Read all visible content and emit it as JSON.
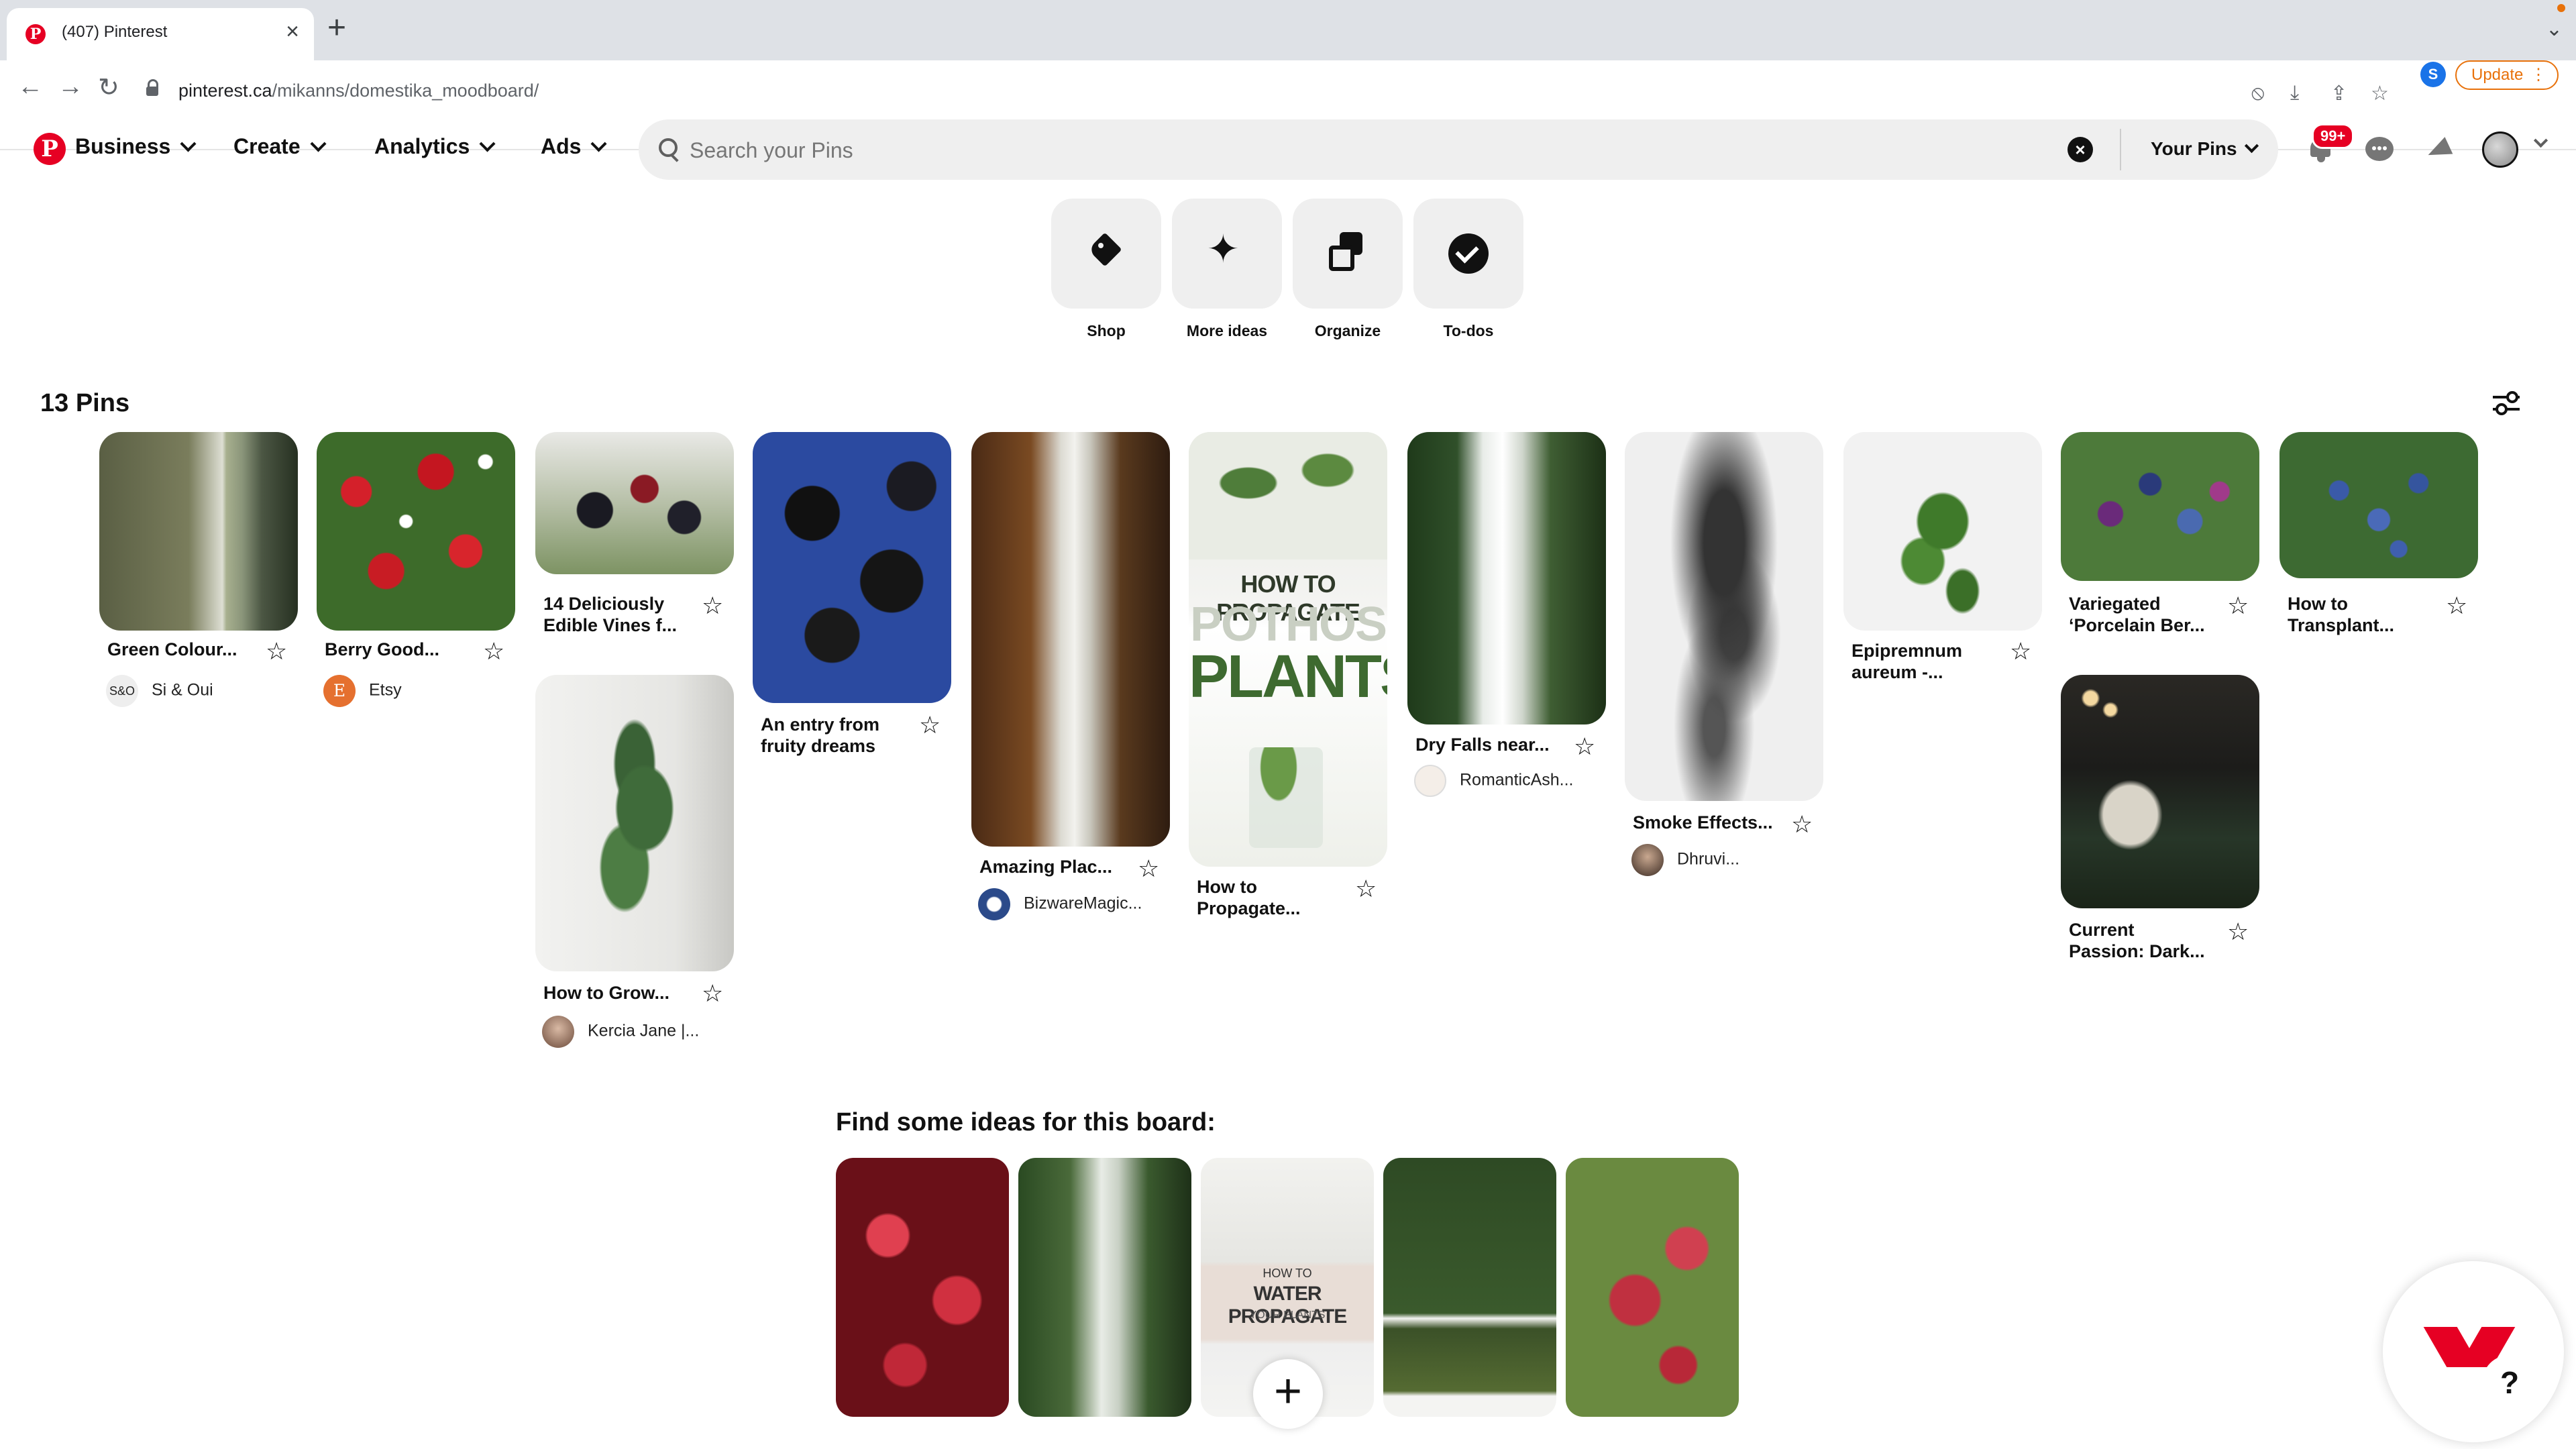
{
  "browser": {
    "tab_title": "(407) Pinterest",
    "url_host": "pinterest.ca",
    "url_path": "/mikanns/domestika_moodboard/",
    "profile_initial": "S",
    "update_label": "Update"
  },
  "header": {
    "nav": [
      "Business",
      "Create",
      "Analytics",
      "Ads"
    ],
    "search_placeholder": "Search your Pins",
    "your_pins_label": "Your Pins",
    "notifications_badge": "99+"
  },
  "tools": [
    {
      "label": "Shop",
      "icon": "tag-icon"
    },
    {
      "label": "More ideas",
      "icon": "sparkle-icon"
    },
    {
      "label": "Organize",
      "icon": "organize-icon"
    },
    {
      "label": "To-dos",
      "icon": "check-circle-icon"
    }
  ],
  "board": {
    "pin_count": "13 Pins"
  },
  "pins": [
    {
      "title1": "Green Colour...",
      "title2": "",
      "creator": "Si & Oui",
      "creator_avatar": "S&O"
    },
    {
      "title1": "Berry Good...",
      "title2": "",
      "creator": "Etsy",
      "creator_avatar": "E"
    },
    {
      "title1": "14 Deliciously",
      "title2": "Edible Vines f...",
      "creator": "",
      "creator_avatar": ""
    },
    {
      "title1": "How to Grow...",
      "title2": "",
      "creator": "Kercia Jane |...",
      "creator_avatar": ""
    },
    {
      "title1": "An entry from",
      "title2": "fruity dreams",
      "creator": "",
      "creator_avatar": ""
    },
    {
      "title1": "Amazing Plac...",
      "title2": "",
      "creator": "BizwareMagic...",
      "creator_avatar": ""
    },
    {
      "title1": "How to",
      "title2": "Propagate...",
      "creator": "",
      "creator_avatar": "",
      "image_text1": "HOW TO PROPAGATE",
      "image_text2": "POTHOS",
      "image_text3": "PLANTS"
    },
    {
      "title1": "Dry Falls near...",
      "title2": "",
      "creator": "RomanticAsh...",
      "creator_avatar": ""
    },
    {
      "title1": "Smoke Effects...",
      "title2": "",
      "creator": "Dhruvi...",
      "creator_avatar": ""
    },
    {
      "title1": "Epipremnum",
      "title2": "aureum -...",
      "creator": "",
      "creator_avatar": ""
    },
    {
      "title1": "Variegated",
      "title2": "‘Porcelain Ber...",
      "creator": "",
      "creator_avatar": ""
    },
    {
      "title1": "Current",
      "title2": "Passion: Dark...",
      "creator": "",
      "creator_avatar": ""
    },
    {
      "title1": "How to",
      "title2": "Transplant...",
      "creator": "",
      "creator_avatar": ""
    }
  ],
  "ideas": {
    "title": "Find some ideas for this board:",
    "card3_text1": "HOW TO",
    "card3_text2": "WATER PROPAGATE",
    "card3_text3": "YOUR PLANTS"
  },
  "colors": {
    "brand": "#e60023",
    "search_bg": "#efefef"
  }
}
